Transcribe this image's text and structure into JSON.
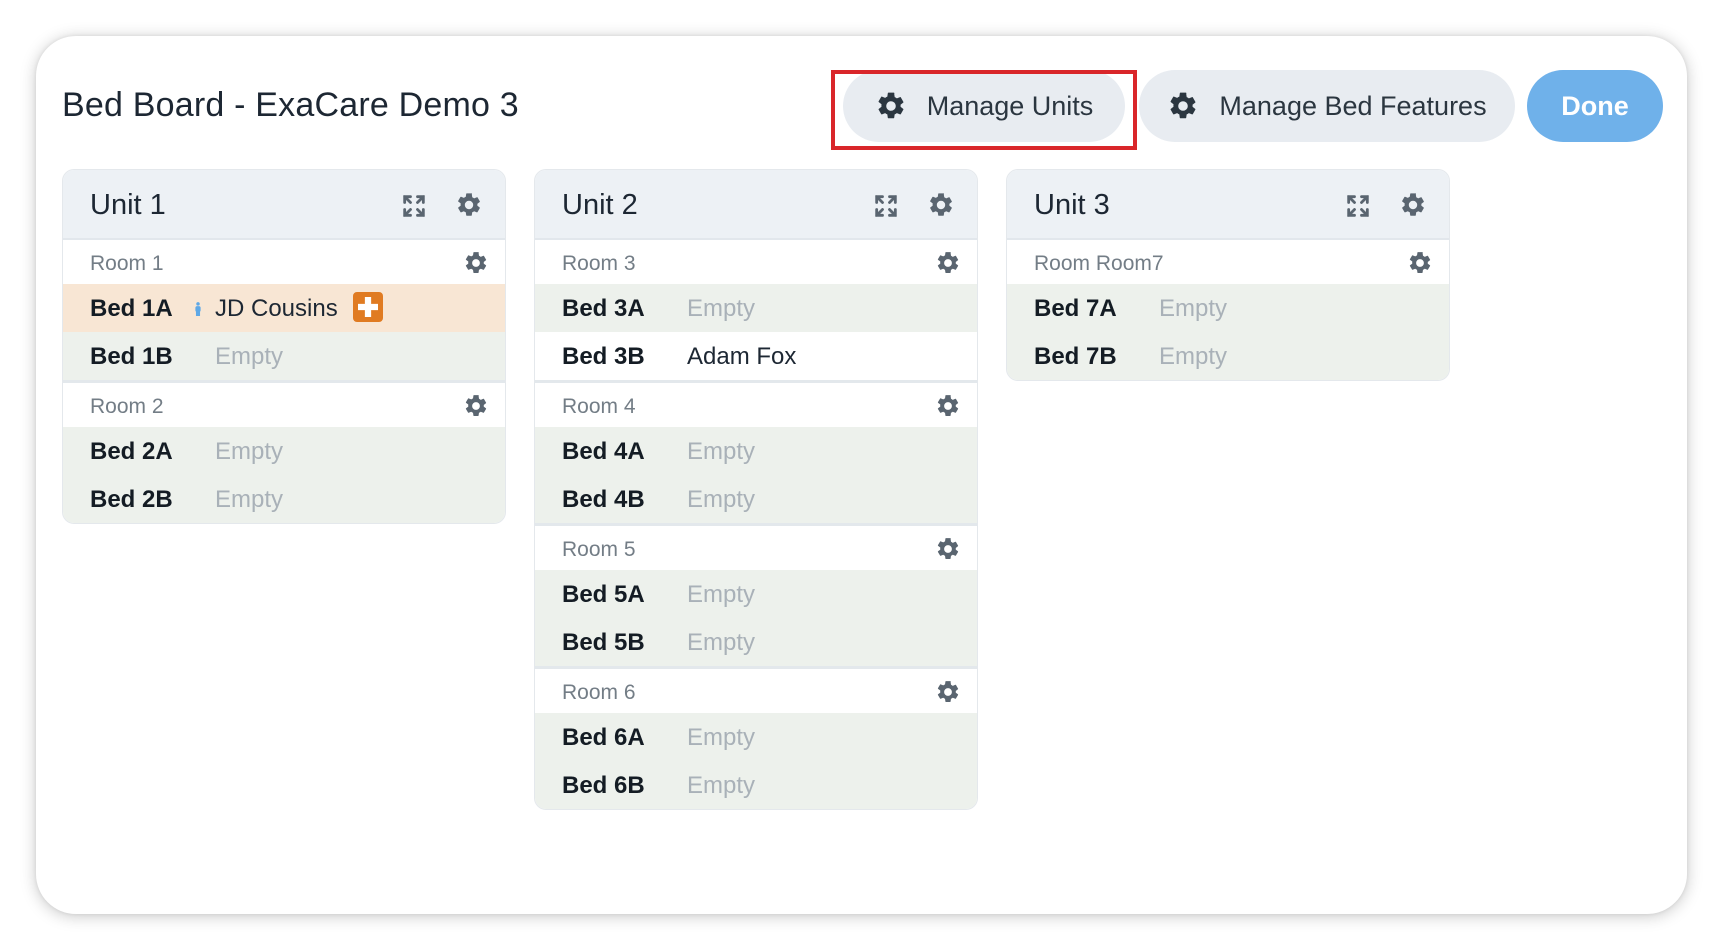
{
  "header": {
    "title": "Bed Board - ExaCare Demo 3",
    "manage_units_label": "Manage Units",
    "manage_bed_features_label": "Manage Bed Features",
    "done_label": "Done"
  },
  "colors": {
    "accent": "#6fb1ea",
    "empty_bed_bg": "#edf1ec",
    "flagged_bed_bg": "#f8e6d4",
    "highlight": "#d9262a",
    "badge": "#e07b22"
  },
  "units": [
    {
      "name": "Unit 1",
      "rooms": [
        {
          "name": "Room 1",
          "beds": [
            {
              "label": "Bed 1A",
              "status": "JD Cousins",
              "occupied": true,
              "flagged": true,
              "icon": "person-icon",
              "badge": "medical-cross-icon"
            },
            {
              "label": "Bed 1B",
              "status": "Empty"
            }
          ]
        },
        {
          "name": "Room 2",
          "beds": [
            {
              "label": "Bed 2A",
              "status": "Empty"
            },
            {
              "label": "Bed 2B",
              "status": "Empty"
            }
          ]
        }
      ]
    },
    {
      "name": "Unit 2",
      "rooms": [
        {
          "name": "Room 3",
          "beds": [
            {
              "label": "Bed 3A",
              "status": "Empty"
            },
            {
              "label": "Bed 3B",
              "status": "Adam Fox",
              "occupied": true
            }
          ]
        },
        {
          "name": "Room 4",
          "beds": [
            {
              "label": "Bed 4A",
              "status": "Empty"
            },
            {
              "label": "Bed 4B",
              "status": "Empty"
            }
          ]
        },
        {
          "name": "Room 5",
          "beds": [
            {
              "label": "Bed 5A",
              "status": "Empty"
            },
            {
              "label": "Bed 5B",
              "status": "Empty"
            }
          ]
        },
        {
          "name": "Room 6",
          "beds": [
            {
              "label": "Bed 6A",
              "status": "Empty"
            },
            {
              "label": "Bed 6B",
              "status": "Empty"
            }
          ]
        }
      ]
    },
    {
      "name": "Unit 3",
      "rooms": [
        {
          "name": "Room Room7",
          "beds": [
            {
              "label": "Bed 7A",
              "status": "Empty"
            },
            {
              "label": "Bed 7B",
              "status": "Empty"
            }
          ]
        }
      ]
    }
  ]
}
